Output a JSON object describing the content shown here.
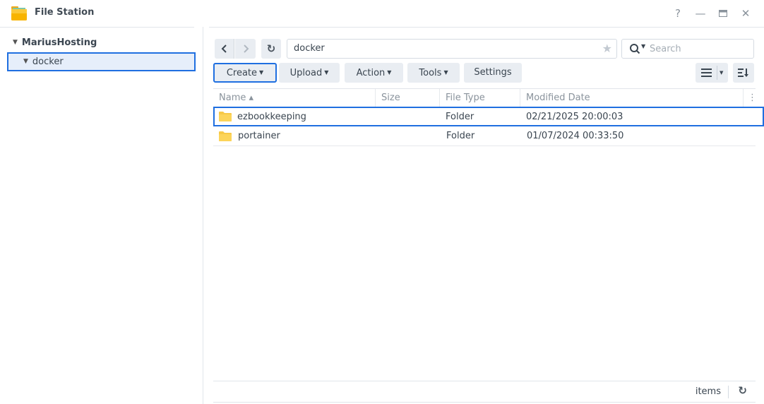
{
  "window": {
    "title": "File Station",
    "controls": {
      "help": "?",
      "minimize": "—",
      "maximize": "▭",
      "close": "✕"
    }
  },
  "sidebar": {
    "root": "MariusHosting",
    "items": [
      {
        "label": "docker",
        "selected": true
      }
    ]
  },
  "navigation": {
    "back": "‹",
    "forward": "›",
    "refresh": "↻",
    "path": "docker",
    "search_placeholder": "Search"
  },
  "toolbar": {
    "buttons": [
      {
        "label": "Create",
        "dropdown": true,
        "active": true
      },
      {
        "label": "Upload",
        "dropdown": true
      },
      {
        "label": "Action",
        "dropdown": true
      },
      {
        "label": "Tools",
        "dropdown": true
      },
      {
        "label": "Settings",
        "dropdown": false
      }
    ]
  },
  "table": {
    "columns": [
      "Name ▴",
      "Size",
      "File Type",
      "Modified Date"
    ],
    "rows": [
      {
        "name": "ezbookkeeping",
        "size": "",
        "type": "Folder",
        "modified": "02/21/2025 20:00:03",
        "selected": true
      },
      {
        "name": "portainer",
        "size": "",
        "type": "Folder",
        "modified": "01/07/2024 00:33:50",
        "selected": false
      }
    ]
  },
  "footer": {
    "items_label": "items"
  },
  "colors": {
    "accent": "#1f6fe0",
    "selection_bg": "#e6eefa",
    "button_bg": "#e9edf2",
    "folder": "#f7c948"
  }
}
